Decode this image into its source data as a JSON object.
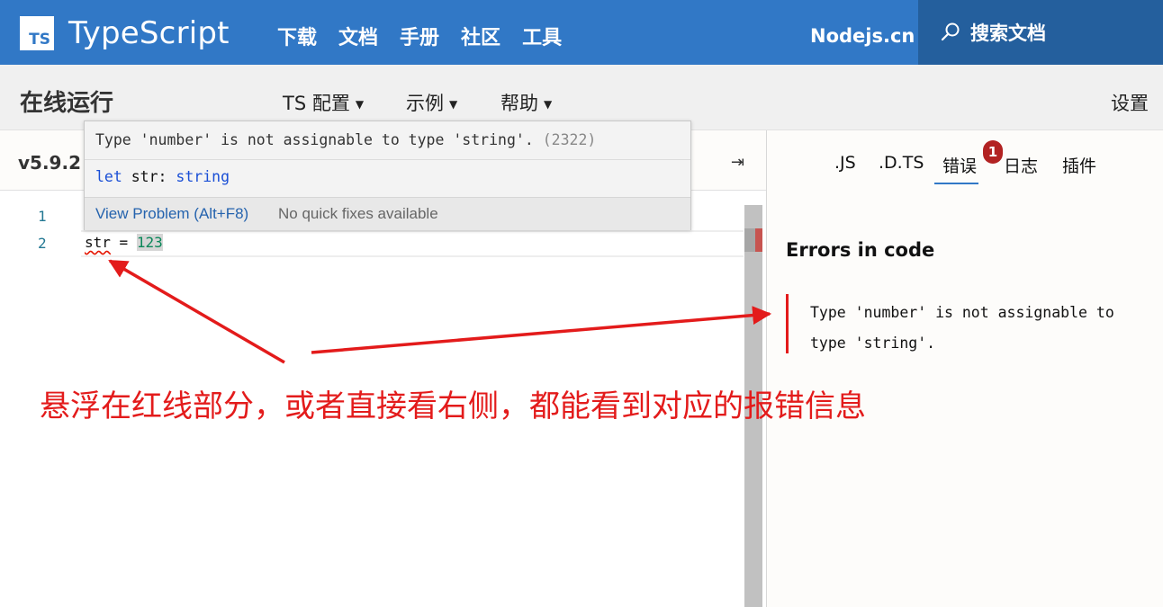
{
  "topnav": {
    "logo_text": "TS",
    "brand": "TypeScript",
    "links": [
      "下载",
      "文档",
      "手册",
      "社区",
      "工具"
    ],
    "site": "Nodejs.cn",
    "search_label": "搜索文档"
  },
  "subnav": {
    "title": "在线运行",
    "menu": [
      "TS 配置",
      "示例",
      "帮助"
    ],
    "settings": "设置"
  },
  "editor": {
    "version": "v5.9.2",
    "line_numbers": [
      "1",
      "2"
    ],
    "code_var": "str",
    "code_op": " = ",
    "code_num": "123"
  },
  "hover": {
    "message": "Type 'number' is not assignable to type 'string'.",
    "error_code": "(2322)",
    "sig_keyword": "let",
    "sig_rest": " str: ",
    "sig_type": "string",
    "view_problem": "View Problem (Alt+F8)",
    "no_fixes": "No quick fixes available"
  },
  "sidebar": {
    "tabs": [
      ".JS",
      ".D.TS",
      "错误",
      "日志",
      "插件"
    ],
    "badge": "1",
    "heading": "Errors in code",
    "error_message": "Type 'number' is not assignable to type 'string'."
  },
  "annotation": "悬浮在红线部分，或者直接看右侧，都能看到对应的报错信息",
  "colors": {
    "brand_blue": "#3178c6",
    "annotation_red": "#e31b1b",
    "badge_red": "#b22222"
  }
}
